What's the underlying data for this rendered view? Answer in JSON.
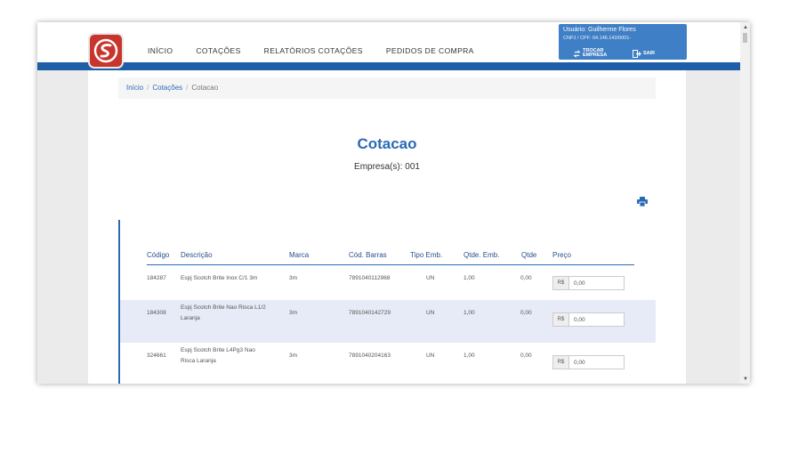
{
  "nav": {
    "items": [
      "INÍCIO",
      "COTAÇÕES",
      "RELATÓRIOS COTAÇÕES",
      "PEDIDOS DE COMPRA"
    ]
  },
  "user": {
    "label": "Usuário: Guilherme Flores",
    "company": "CNPJ / CPF: 04.146.142/0001-",
    "switch_label": "TROCAR EMPRESA",
    "logout_label": "SAIR"
  },
  "breadcrumb": {
    "items": [
      "Início",
      "Cotações",
      "Cotacao"
    ]
  },
  "page": {
    "title": "Cotacao",
    "subtitle": "Empresa(s): 001"
  },
  "table": {
    "headers": [
      "Código",
      "Descrição",
      "Marca",
      "Cód. Barras",
      "Tipo Emb.",
      "Qtde. Emb.",
      "Qtde",
      "Preço"
    ],
    "currency": "R$",
    "rows": [
      {
        "codigo": "184287",
        "descricao_1": "Espj Scotch Brite Inox C/1 3m",
        "descricao_2": "",
        "marca": "3m",
        "barras": "7891040112968",
        "tipo": "UN",
        "qtde_emb": "1,00",
        "qtde": "0,00",
        "preco": "0,00"
      },
      {
        "codigo": "184308",
        "descricao_1": "Espj Scotch Brite Nao Risca L1/2",
        "descricao_2": "Laranja",
        "marca": "3m",
        "barras": "7891040142729",
        "tipo": "UN",
        "qtde_emb": "1,00",
        "qtde": "0,00",
        "preco": "0,00"
      },
      {
        "codigo": "324661",
        "descricao_1": "Espj Scotch Brite L4Pg3 Nao",
        "descricao_2": "Risca Laranja",
        "marca": "3m",
        "barras": "7891040204163",
        "tipo": "UN",
        "qtde_emb": "1,00",
        "qtde": "0,00",
        "preco": "0,00"
      }
    ]
  },
  "colors": {
    "brand_blue": "#2a6ab5",
    "bar_blue": "#1f5fa8",
    "logo_red": "#c8352c",
    "row_alt": "#e6ebf7"
  },
  "icons": [
    "logo-icon",
    "swap-icon",
    "logout-icon",
    "print-icon"
  ]
}
